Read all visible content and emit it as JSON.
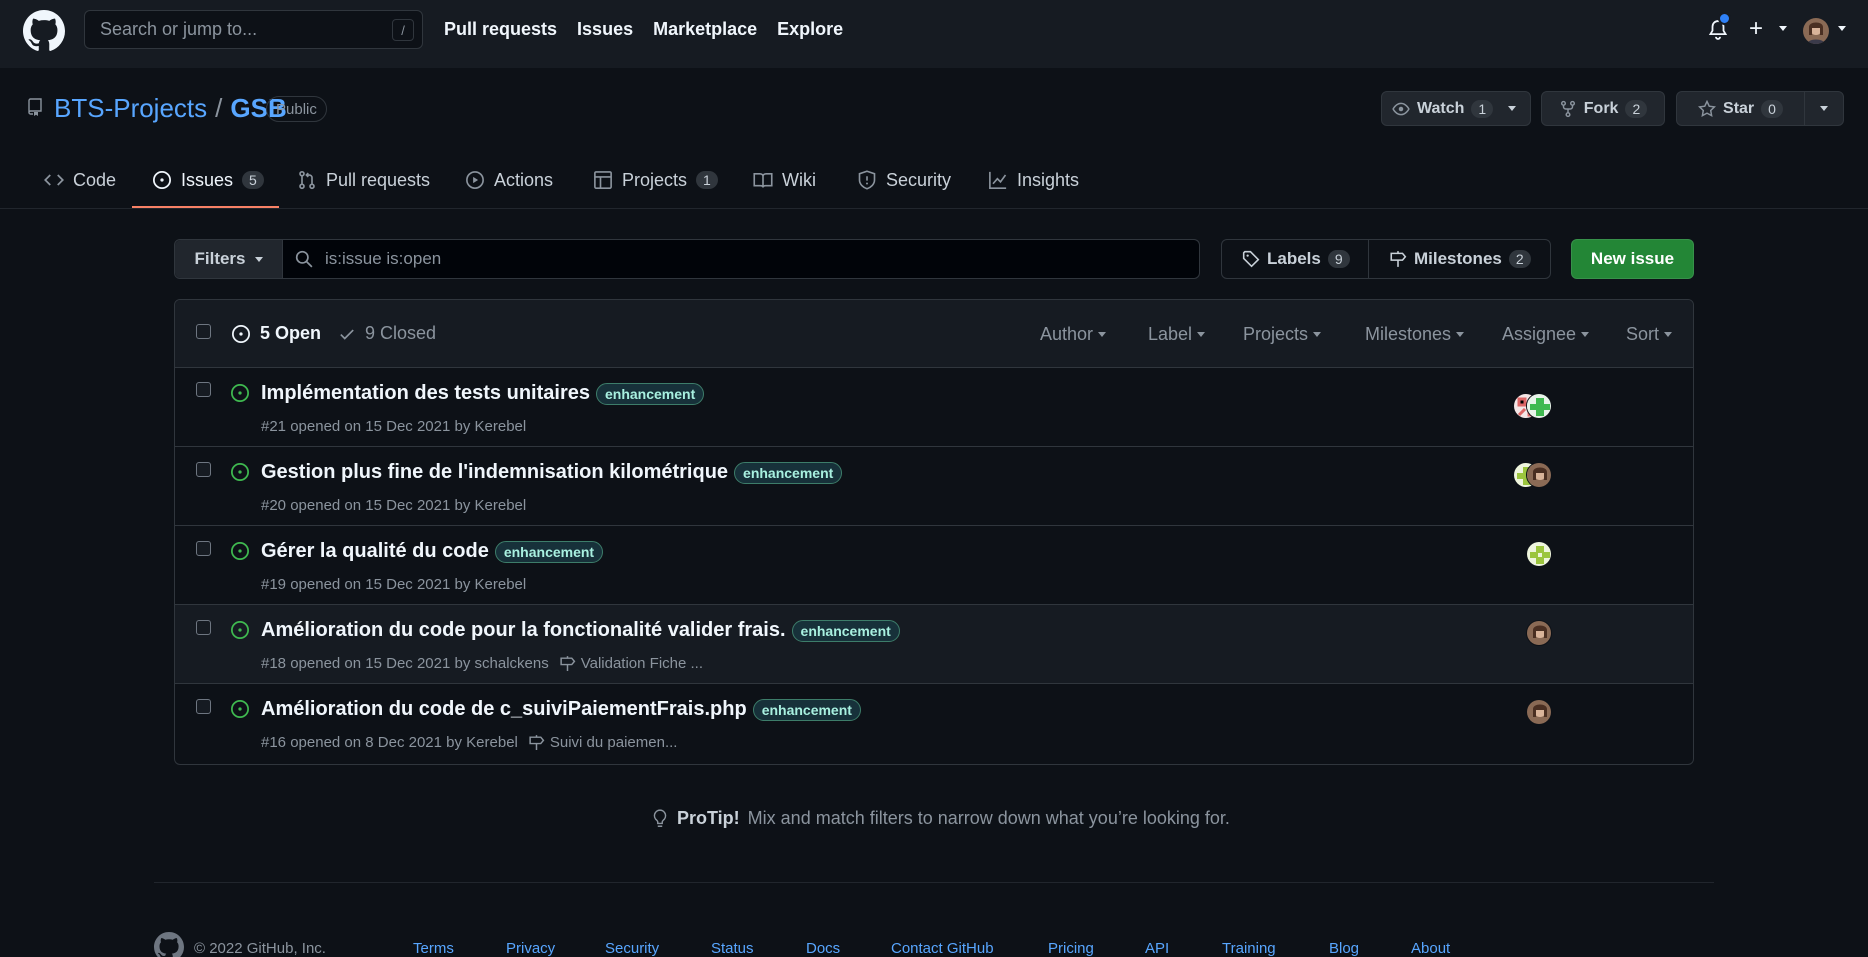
{
  "header": {
    "search_placeholder": "Search or jump to...",
    "search_shortcut": "/",
    "nav": [
      "Pull requests",
      "Issues",
      "Marketplace",
      "Explore"
    ]
  },
  "repo": {
    "owner": "BTS-Projects",
    "separator": "/",
    "name": "GSB",
    "visibility": "Public",
    "watch": {
      "label": "Watch",
      "count": "1"
    },
    "fork": {
      "label": "Fork",
      "count": "2"
    },
    "star": {
      "label": "Star",
      "count": "0"
    }
  },
  "tabs": [
    {
      "label": "Code",
      "icon": "code-icon"
    },
    {
      "label": "Issues",
      "count": "5",
      "icon": "issue-opened-icon",
      "active": true
    },
    {
      "label": "Pull requests",
      "icon": "git-pull-request-icon"
    },
    {
      "label": "Actions",
      "icon": "play-icon"
    },
    {
      "label": "Projects",
      "count": "1",
      "icon": "table-icon"
    },
    {
      "label": "Wiki",
      "icon": "book-icon"
    },
    {
      "label": "Security",
      "icon": "shield-icon"
    },
    {
      "label": "Insights",
      "icon": "graph-icon"
    }
  ],
  "toolbar": {
    "filters_label": "Filters",
    "search_value": "is:issue is:open",
    "labels": {
      "label": "Labels",
      "count": "9"
    },
    "milestones": {
      "label": "Milestones",
      "count": "2"
    },
    "new_issue": "New issue"
  },
  "list_header": {
    "open": "5 Open",
    "closed": "9 Closed",
    "filters": [
      "Author",
      "Label",
      "Projects",
      "Milestones",
      "Assignee",
      "Sort"
    ]
  },
  "issues": [
    {
      "title": "Implémentation des tests unitaires",
      "label": "enhancement",
      "meta": "#21 opened on 15 Dec 2021 by Kerebel",
      "milestone": ""
    },
    {
      "title": "Gestion plus fine de l'indemnisation kilométrique",
      "label": "enhancement",
      "meta": "#20 opened on 15 Dec 2021 by Kerebel",
      "milestone": ""
    },
    {
      "title": "Gérer la qualité du code",
      "label": "enhancement",
      "meta": "#19 opened on 15 Dec 2021 by Kerebel",
      "milestone": ""
    },
    {
      "title": "Amélioration du code pour la fonctionalité valider frais.",
      "label": "enhancement",
      "meta": "#18 opened on 15 Dec 2021 by schalckens",
      "milestone": "Validation Fiche ..."
    },
    {
      "title": "Amélioration du code de c_suiviPaiementFrais.php",
      "label": "enhancement",
      "meta": "#16 opened on 8 Dec 2021 by Kerebel",
      "milestone": "Suivi du paiemen..."
    }
  ],
  "protip": {
    "strong": "ProTip!",
    "text": " Mix and match filters to narrow down what you’re looking for."
  },
  "footer": {
    "copyright": "© 2022 GitHub, Inc.",
    "links": [
      "Terms",
      "Privacy",
      "Security",
      "Status",
      "Docs",
      "Contact GitHub",
      "Pricing",
      "API",
      "Training",
      "Blog",
      "About"
    ]
  },
  "colors": {
    "accent": "#58a6ff",
    "open_green": "#3fb950",
    "primary_button": "#238636",
    "active_tab": "#f78166"
  }
}
